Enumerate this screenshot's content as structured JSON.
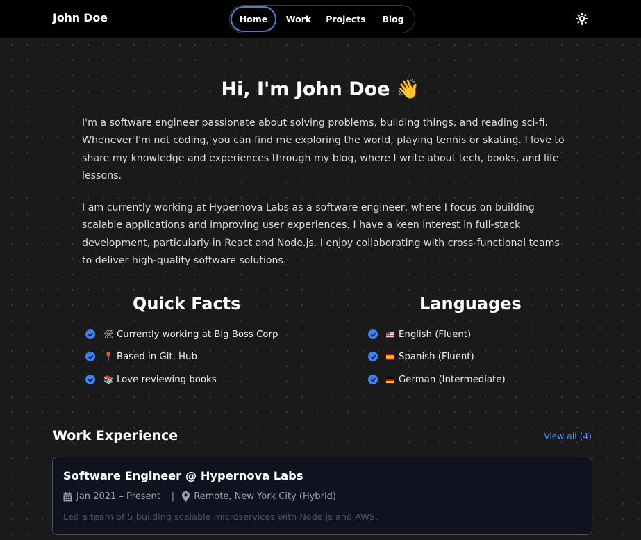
{
  "header": {
    "brand": "John Doe",
    "nav": [
      {
        "label": "Home",
        "active": true
      },
      {
        "label": "Work",
        "active": false
      },
      {
        "label": "Projects",
        "active": false
      },
      {
        "label": "Blog",
        "active": false
      }
    ],
    "theme_toggle_icon": "sun-icon"
  },
  "hero": {
    "title": "Hi, I'm John Doe 👋",
    "paragraphs": [
      "I'm a software engineer passionate about solving problems, building things, and reading sci-fi. Whenever I'm not coding, you can find me exploring the world, playing tennis or skating. I love to share my knowledge and experiences through my blog, where I write about tech, books, and life lessons.",
      "I am currently working at Hypernova Labs as a software engineer, where I focus on building scalable applications and improving user experiences. I have a keen interest in full-stack development, particularly in React and Node.js. I enjoy collaborating with cross-functional teams to deliver high-quality software solutions."
    ]
  },
  "quick_facts": {
    "title": "Quick Facts",
    "items": [
      {
        "emoji": "🛠",
        "text": "Currently working at Big Boss Corp"
      },
      {
        "emoji": "📍",
        "text": "Based in Git, Hub"
      },
      {
        "emoji": "📚",
        "text": "Love reviewing books"
      }
    ]
  },
  "languages": {
    "title": "Languages",
    "items": [
      {
        "flag": "us-flag-icon",
        "text": "English (Fluent)"
      },
      {
        "flag": "es-flag-icon",
        "text": "Spanish (Fluent)"
      },
      {
        "flag": "de-flag-icon",
        "text": "German (Intermediate)"
      }
    ]
  },
  "work": {
    "title": "Work Experience",
    "view_all": "View all (4)",
    "cards": [
      {
        "title": "Software Engineer @ Hypernova Labs",
        "dates": "Jan 2021 – Present",
        "location": "Remote, New York City (Hybrid)",
        "description": "Led a team of 5 building scalable microservices with Node.js and AWS."
      }
    ]
  },
  "colors": {
    "accent": "#3b82f6",
    "link": "#4a8dff",
    "background": "#1a1a1a",
    "header": "#000000",
    "card": "#0f1320"
  }
}
